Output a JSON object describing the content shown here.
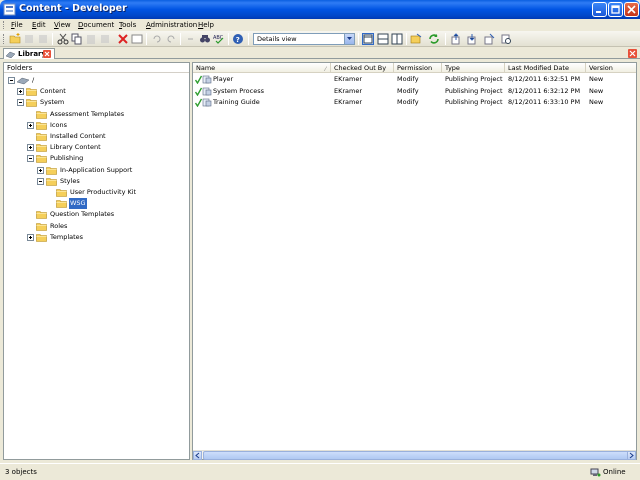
{
  "window": {
    "title": "Content - Developer"
  },
  "menu": {
    "items": [
      {
        "first": "F",
        "rest": "ile"
      },
      {
        "first": "E",
        "rest": "dit"
      },
      {
        "first": "V",
        "rest": "iew"
      },
      {
        "first": "D",
        "rest": "ocument"
      },
      {
        "first": "T",
        "rest": "ools"
      },
      {
        "first": "A",
        "rest": "dministration"
      },
      {
        "first": "H",
        "rest": "elp"
      }
    ]
  },
  "toolbar": {
    "view_select": "Details view"
  },
  "tabs": {
    "active": "Library"
  },
  "folders": {
    "header": "Folders",
    "root": "/",
    "tree": [
      {
        "label": "Content",
        "expander": "plus"
      },
      {
        "label": "System",
        "expander": "minus"
      },
      {
        "label": "Assessment Templates",
        "expander": "none"
      },
      {
        "label": "Icons",
        "expander": "plus"
      },
      {
        "label": "Installed Content",
        "expander": "none"
      },
      {
        "label": "Library Content",
        "expander": "plus"
      },
      {
        "label": "Publishing",
        "expander": "minus"
      },
      {
        "label": "In-Application Support",
        "expander": "plus"
      },
      {
        "label": "Styles",
        "expander": "minus"
      },
      {
        "label": "User Productivity Kit",
        "expander": "none"
      },
      {
        "label": "WSG",
        "expander": "none"
      },
      {
        "label": "Question Templates",
        "expander": "none"
      },
      {
        "label": "Roles",
        "expander": "none"
      },
      {
        "label": "Templates",
        "expander": "plus"
      }
    ],
    "selected": "WSG"
  },
  "list": {
    "columns": [
      "Name",
      "Checked Out By",
      "Permission",
      "Type",
      "Last Modified Date",
      "Version"
    ],
    "rows": [
      {
        "name": "Player",
        "checked_out_by": "EKramer",
        "permission": "Modify",
        "type": "Publishing Project",
        "modified": "8/12/2011 6:32:51 PM",
        "version": "New"
      },
      {
        "name": "System Process",
        "checked_out_by": "EKramer",
        "permission": "Modify",
        "type": "Publishing Project",
        "modified": "8/12/2011 6:32:12 PM",
        "version": "New"
      },
      {
        "name": "Training Guide",
        "checked_out_by": "EKramer",
        "permission": "Modify",
        "type": "Publishing Project",
        "modified": "8/12/2011 6:33:10 PM",
        "version": "New"
      }
    ]
  },
  "status": {
    "count": "3 objects",
    "connection": "Online"
  },
  "colors": {
    "title_bar": "#0054e3",
    "selection": "#316ac5",
    "folder": "#f5cf5a",
    "check": "#2e9e2e"
  }
}
